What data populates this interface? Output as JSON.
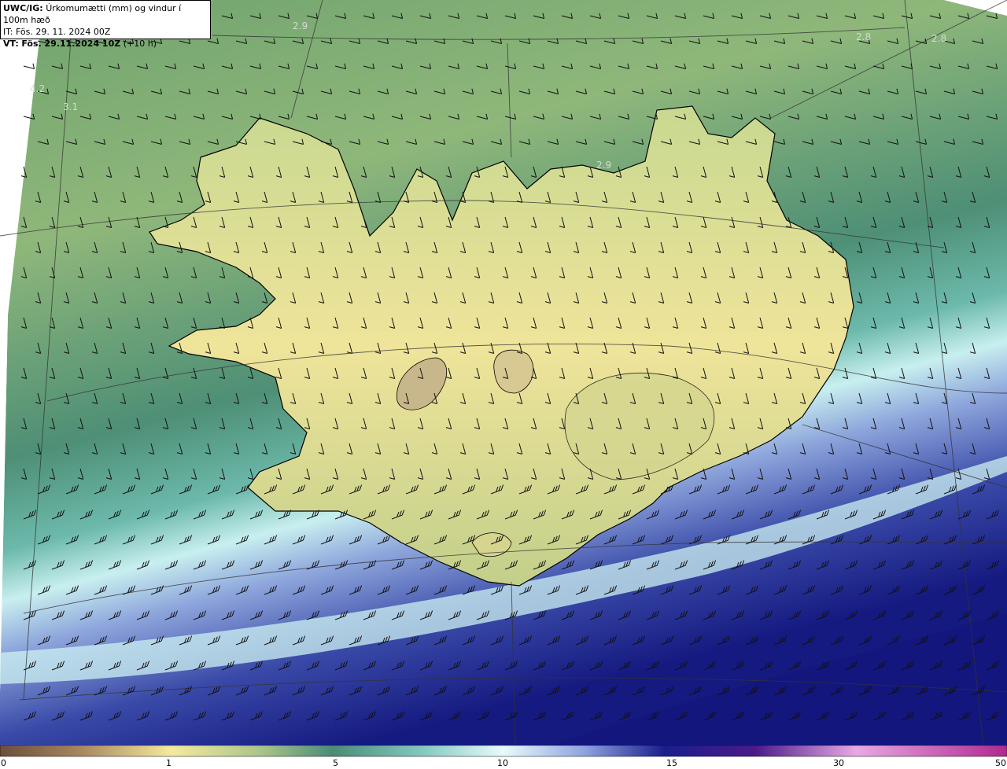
{
  "header": {
    "model": "UWC/IG:",
    "description": "Úrkomumætti (mm) og vindur í 100m hæð",
    "init_label": "IT:",
    "init_time": "Fös. 29. 11. 2024 00Z",
    "valid_label": "VT:",
    "valid_time": "Fös. 29.11.2024 10Z",
    "lead": "(+10 h)"
  },
  "pressure_labels": [
    "2.9",
    "2.8",
    "2.8",
    "4.2",
    "3.1",
    "2.9"
  ],
  "colorbar": {
    "ticks": [
      "0",
      "1",
      "5",
      "10",
      "15",
      "30",
      "50"
    ],
    "colors": [
      "#6b4f3a",
      "#c2a878",
      "#f4ea9c",
      "#8fb37f",
      "#4b8c77",
      "#bfefef",
      "#7c8fd8",
      "#1a1e8c",
      "#4c1a8a",
      "#e06bd0",
      "#c43aa2"
    ]
  },
  "colors": {
    "sea_north": "#5f9a6f",
    "land_dry": "#efe497",
    "precip_band_light": "#c9f0f0",
    "precip_heavy": "#16197c"
  }
}
